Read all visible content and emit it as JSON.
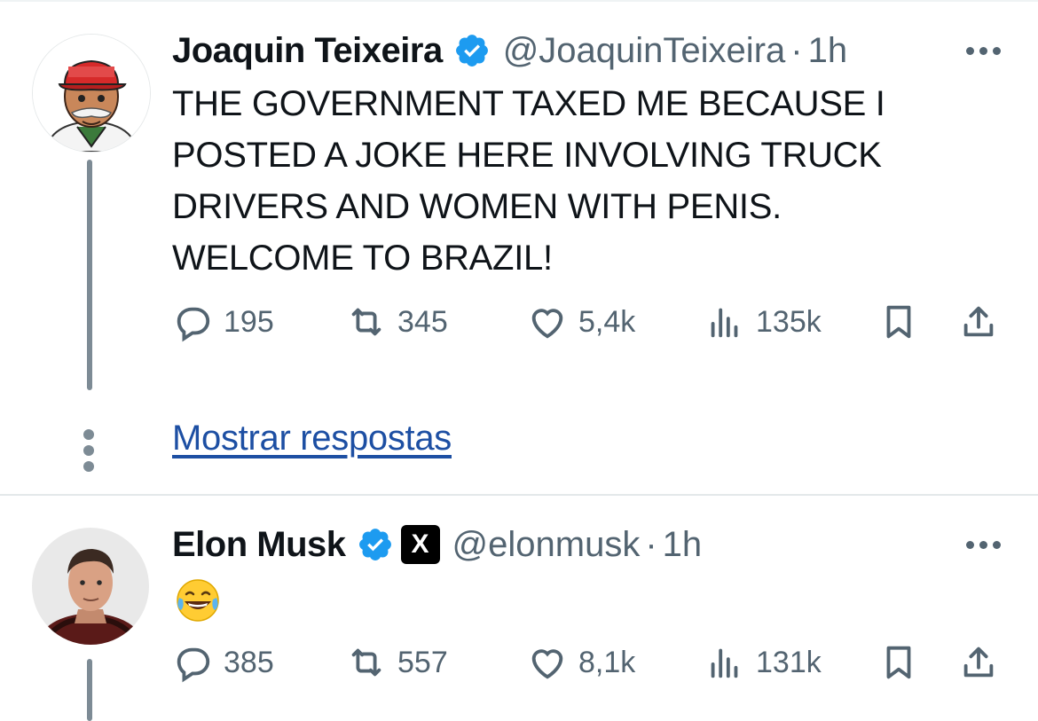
{
  "tweets": [
    {
      "author_name": "Joaquin Teixeira",
      "handle": "@JoaquinTeixeira",
      "separator": "·",
      "time": "1h",
      "avatar_icon": "cartoon-man-red-cap-avatar",
      "text": "THE GOVERNMENT TAXED ME BECAUSE I\nPOSTED A JOKE HERE INVOLVING TRUCK\nDRIVERS AND WOMEN WITH PENIS.\nWELCOME TO BRAZIL!",
      "stats": {
        "replies": "195",
        "reposts": "345",
        "likes": "5,4k",
        "views": "135k"
      },
      "show_replies_label": "Mostrar respostas"
    },
    {
      "author_name": "Elon Musk",
      "handle": "@elonmusk",
      "separator": "·",
      "time": "1h",
      "avatar_icon": "man-portrait-avatar",
      "affiliate_badge": "X",
      "emoji": "face-with-tears-of-joy",
      "stats": {
        "replies": "385",
        "reposts": "557",
        "likes": "8,1k",
        "views": "131k"
      }
    }
  ],
  "colors": {
    "verified_blue": "#1d9bf0",
    "secondary_text": "#536471",
    "link": "#1d4fa3",
    "thread_line": "#7d8b95"
  }
}
